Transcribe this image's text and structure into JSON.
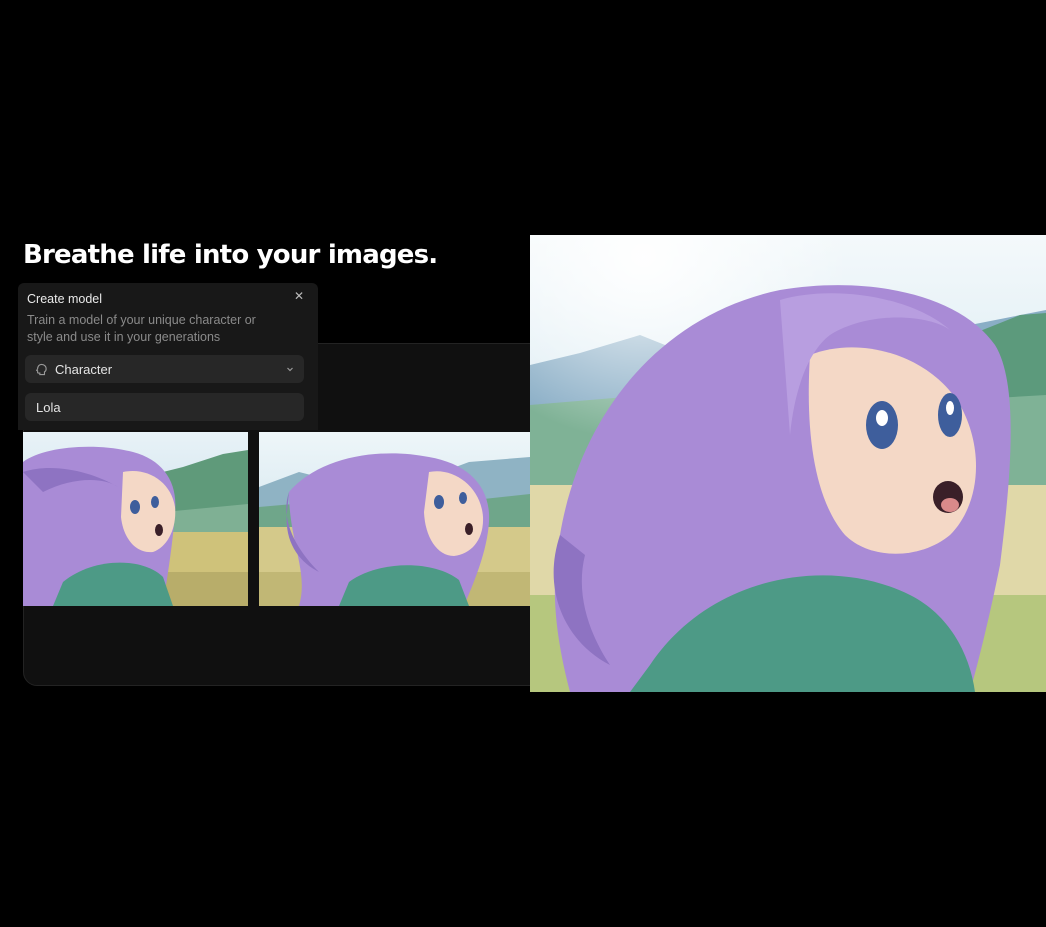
{
  "headline": "Breathe life into your images.",
  "modal": {
    "title": "Create model",
    "description": "Train a model of your unique character or style and use it in your generations",
    "close_icon": "close-icon",
    "model_type": {
      "selected": "Character",
      "icon": "character-head-icon",
      "chevron_icon": "chevron-down-icon"
    },
    "name_field": {
      "value": "Lola"
    }
  },
  "images": {
    "thumbnails": [
      {
        "subject": "anime girl with lavender hair in a meadow"
      },
      {
        "subject": "anime girl with lavender hair in a meadow, variation"
      }
    ],
    "hero": {
      "subject": "anime girl with lavender hair looking up, close-up"
    }
  },
  "colors": {
    "background": "#000000",
    "panel": "#101010",
    "modal": "#181818",
    "field": "#272727",
    "hair": "#a98bd6",
    "shirt": "#4d9a86"
  }
}
